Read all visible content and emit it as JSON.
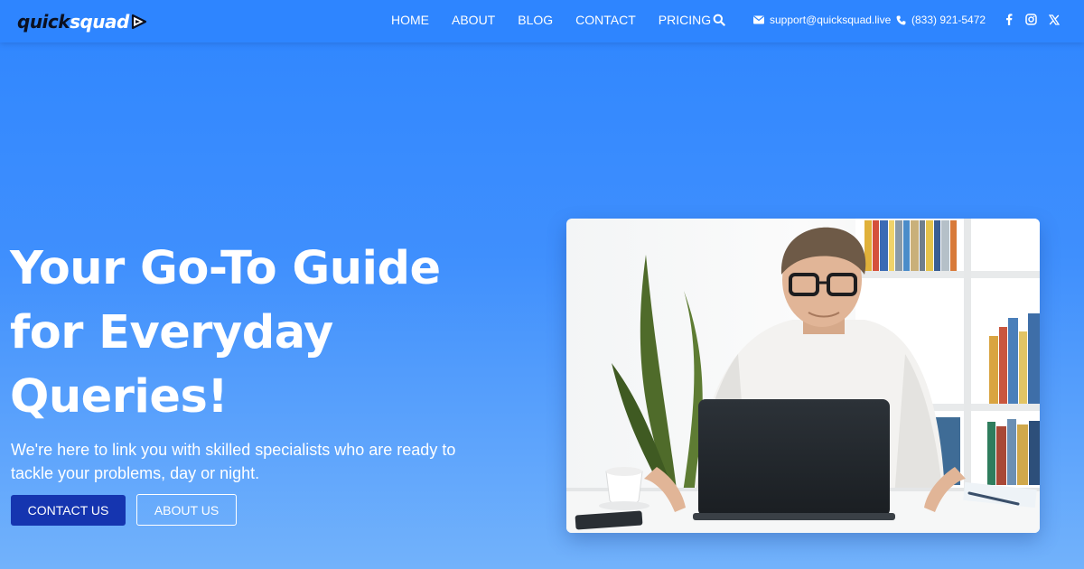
{
  "brand": {
    "name_part1": "quick",
    "name_part2": "squad",
    "logo_icon": "play-arrow-icon"
  },
  "nav": {
    "links": [
      "HOME",
      "ABOUT",
      "BLOG",
      "CONTACT",
      "PRICING"
    ],
    "search_icon": "search-icon"
  },
  "contact": {
    "email": "support@quicksquad.live",
    "email_icon": "envelope-icon",
    "phone": "(833) 921-5472",
    "phone_icon": "phone-icon"
  },
  "socials": [
    "facebook-icon",
    "instagram-icon",
    "x-icon"
  ],
  "hero": {
    "title_line1": "Your Go-To Guide",
    "title_line2": "for Everyday",
    "title_line3": "Queries!",
    "subtitle_line1": "We're here to link you with skilled specialists who are ready to",
    "subtitle_line2": "tackle your problems, day or night.",
    "primary_button": "CONTACT US",
    "secondary_button": "ABOUT US",
    "image_subject": "man-using-laptop-photo"
  },
  "colors": {
    "background_top": "#2f86ff",
    "background_bottom": "#72b2fb",
    "primary_button": "#1535b0",
    "logo_dark": "#0b1020"
  }
}
